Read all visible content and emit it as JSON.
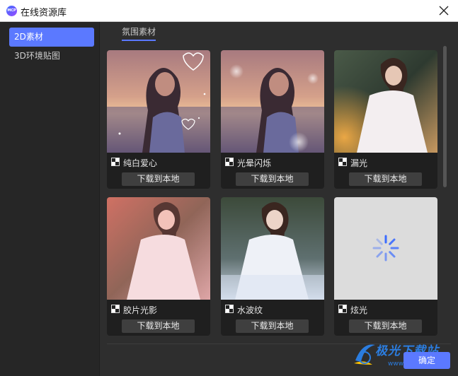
{
  "window": {
    "title": "在线资源库",
    "logo_text": "MCP"
  },
  "sidebar": {
    "items": [
      {
        "label": "2D素材",
        "active": true
      },
      {
        "label": "3D环境贴图",
        "active": false
      }
    ]
  },
  "main": {
    "tab": "氛围素材"
  },
  "cards": [
    {
      "label": "纯白爱心",
      "download_label": "下载到本地",
      "thumb": "hearts"
    },
    {
      "label": "光晕闪烁",
      "download_label": "下载到本地",
      "thumb": "glow"
    },
    {
      "label": "漏光",
      "download_label": "下载到本地",
      "thumb": "leak"
    },
    {
      "label": "胶片光影",
      "download_label": "下载到本地",
      "thumb": "film"
    },
    {
      "label": "水波纹",
      "download_label": "下载到本地",
      "thumb": "ripple"
    },
    {
      "label": "炫光",
      "download_label": "下载到本地",
      "thumb": "loading"
    }
  ],
  "footer": {
    "ok_label": "确定"
  },
  "watermark": {
    "text": "极光下载站",
    "url": "www.xz7.com"
  },
  "colors": {
    "accent": "#5b79ff",
    "window_bg": "#2b2b2b",
    "card_bg": "#1f1f1f",
    "button_bg": "#3f3f3f"
  }
}
